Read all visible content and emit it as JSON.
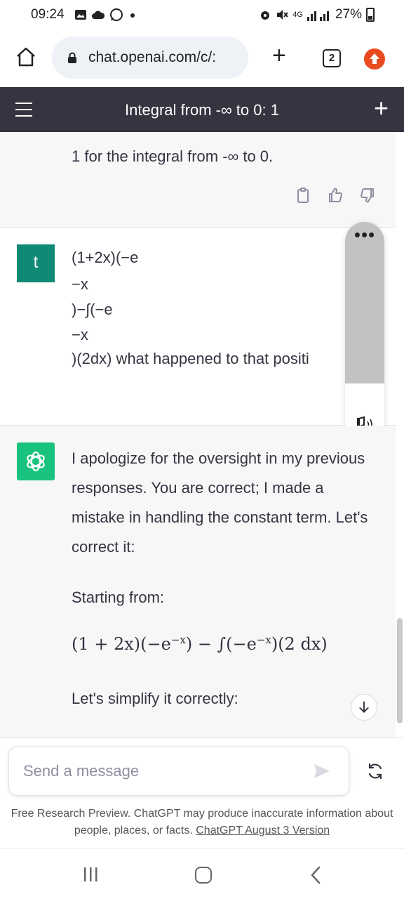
{
  "status_bar": {
    "time": "09:24",
    "network": "4G",
    "battery": "27%"
  },
  "browser": {
    "url": "chat.openai.com/c/:",
    "tab_count": "2"
  },
  "app": {
    "title": "Integral from -∞ to 0: 1"
  },
  "conversation": {
    "assistant_prev_text": "1 for the integral from -∞ to 0.",
    "user_avatar": "t",
    "user_lines": [
      "(1+2x)(−e",
      "−x",
      ")−∫(−e",
      "−x",
      ")(2dx)  what happened  to that positi"
    ],
    "assistant_paragraph": "I apologize for the oversight in my previous responses. You are correct; I made a mistake in handling the constant term. Let's correct it:",
    "assistant_starting": "Starting from:",
    "assistant_math": {
      "part1": "(1 + 2x)(−e",
      "exp1": "−x",
      "part2": ") − ∫(−e",
      "exp2": "−x",
      "part3": ")(2 dx)"
    },
    "assistant_simplify": "Let's simplify it correctly:"
  },
  "composer": {
    "placeholder": "Send a message"
  },
  "footer": {
    "disclaimer": "Free Research Preview. ChatGPT may produce inaccurate information about people, places, or facts.",
    "version_link": "ChatGPT August 3 Version"
  },
  "colors": {
    "header_bg": "#343541",
    "user_avatar_bg": "#0f8b75",
    "gpt_avatar_bg": "#19c37d",
    "update_badge": "#ea4b1e"
  }
}
